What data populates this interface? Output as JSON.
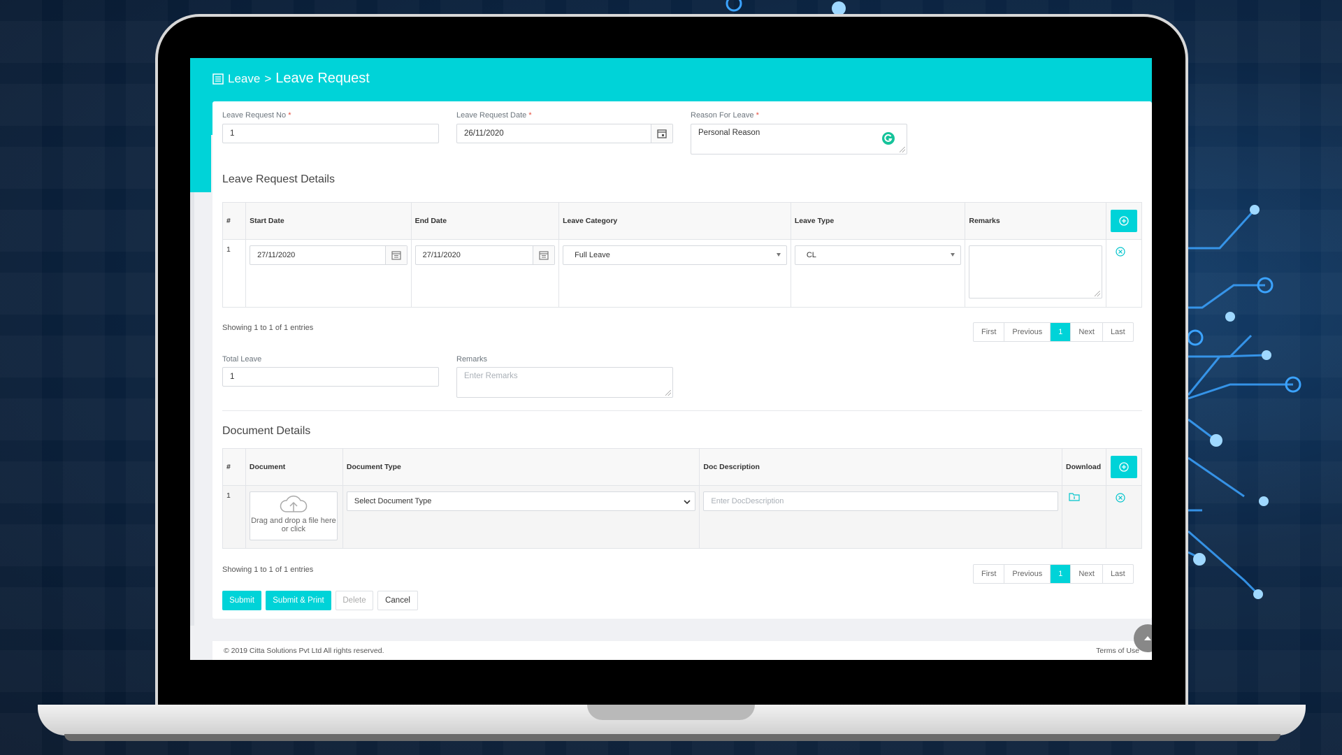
{
  "page": {
    "breadcrumb_parent": "Leave",
    "breadcrumb_sep": ">",
    "title": "Leave Request"
  },
  "form": {
    "request_no": {
      "label": "Leave Request No",
      "required_mark": "*",
      "value": "1"
    },
    "request_date": {
      "label": "Leave Request Date",
      "required_mark": "*",
      "value": "26/11/2020"
    },
    "reason": {
      "label": "Reason For Leave",
      "required_mark": "*",
      "value": "Personal Reason"
    }
  },
  "leave_details": {
    "title": "Leave Request Details",
    "columns": [
      "#",
      "Start Date",
      "End Date",
      "Leave Category",
      "Leave Type",
      "Remarks"
    ],
    "rows": [
      {
        "index": "1",
        "start_date": "27/11/2020",
        "end_date": "27/11/2020",
        "category": "Full Leave",
        "type": "CL",
        "remarks": ""
      }
    ],
    "showing": "Showing 1 to 1 of 1 entries",
    "pager": {
      "first": "First",
      "previous": "Previous",
      "current": "1",
      "next": "Next",
      "last": "Last"
    }
  },
  "summary": {
    "total_leave": {
      "label": "Total Leave",
      "value": "1"
    },
    "remarks": {
      "label": "Remarks",
      "placeholder": "Enter Remarks"
    }
  },
  "document_details": {
    "title": "Document Details",
    "columns": [
      "#",
      "Document",
      "Document Type",
      "Doc Description",
      "Download"
    ],
    "rows": [
      {
        "index": "1",
        "dropzone_text": "Drag and drop a file here or click",
        "doc_type": "Select Document Type",
        "desc_placeholder": "Enter DocDescription"
      }
    ],
    "showing": "Showing 1 to 1 of 1 entries",
    "pager": {
      "first": "First",
      "previous": "Previous",
      "current": "1",
      "next": "Next",
      "last": "Last"
    }
  },
  "actions": {
    "submit": "Submit",
    "submit_print": "Submit & Print",
    "delete": "Delete",
    "cancel": "Cancel"
  },
  "footer": {
    "copyright": "© 2019 Citta Solutions Pvt Ltd All rights reserved.",
    "terms": "Terms of Use"
  },
  "colors": {
    "accent": "#00d3d8",
    "grammarly": "#15c39a",
    "background": "#0b1f38"
  },
  "icons": [
    "form-icon",
    "calendar-icon",
    "grammarly-icon",
    "add-circle-icon",
    "remove-circle-icon",
    "cloud-upload-icon",
    "folder-download-icon",
    "arrow-up-icon"
  ]
}
